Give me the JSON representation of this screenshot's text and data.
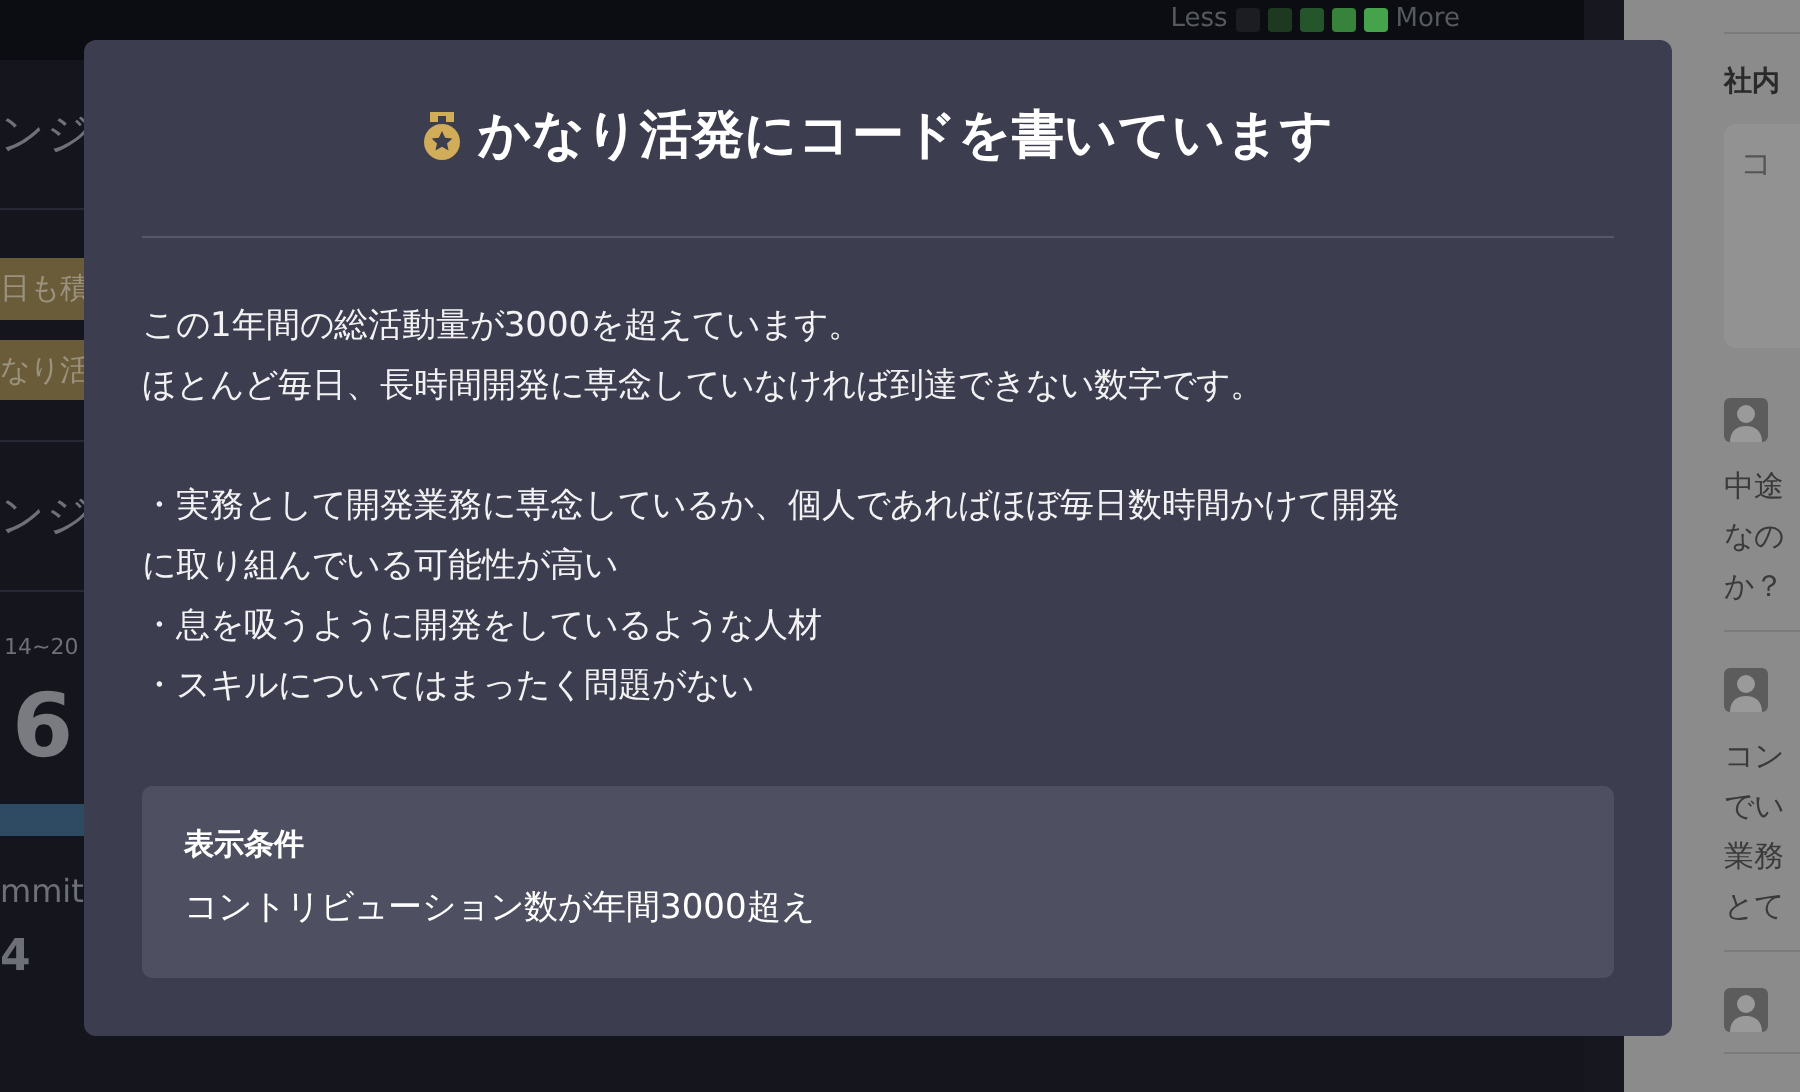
{
  "background": {
    "legend": {
      "less": "Less",
      "more": "More",
      "colors": [
        {
          "color": "#1c1d22"
        },
        {
          "color": "#1d3a21"
        },
        {
          "color": "#25552b"
        },
        {
          "color": "#37833c"
        },
        {
          "color": "#45a34b"
        }
      ]
    },
    "panel": [
      {
        "kind": "heading",
        "text": "ンジ"
      },
      {
        "kind": "divider"
      },
      {
        "kind": "tag",
        "text": "日も積"
      },
      {
        "kind": "tag",
        "text": "なり活"
      },
      {
        "kind": "divider"
      },
      {
        "kind": "heading",
        "text": "ンジ"
      },
      {
        "kind": "divider"
      },
      {
        "kind": "period",
        "text": "14~20"
      },
      {
        "kind": "big",
        "text": "6"
      },
      {
        "kind": "bar",
        "level": 0.4
      },
      {
        "kind": "label",
        "text": "mmit"
      },
      {
        "kind": "number",
        "text": "4"
      }
    ],
    "sidebar": {
      "title": "社内",
      "comment_placeholder": "コ",
      "comments": [
        {
          "lines": [
            "中途",
            "なの",
            "か？"
          ]
        },
        {
          "lines": [
            "コン",
            "でい",
            "業務",
            "とて"
          ]
        }
      ],
      "more_below": true
    }
  },
  "modal": {
    "title": "かなり活発にコードを書いています",
    "paragraphs": [
      [
        "この1年間の総活動量が3000を超えています。",
        "ほとんど毎日、長時間開発に専念していなければ到達できない数字です。"
      ],
      [
        "・実務として開発業務に専念しているか、個人であればほぼ毎日数時間かけて開発",
        "に取り組んでいる可能性が高い",
        "・息を吸うように開発をしているような人材",
        "・スキルについてはまったく問題がない"
      ]
    ],
    "condition": {
      "heading": "表示条件",
      "text": "コントリビューション数が年間3000超え"
    }
  }
}
